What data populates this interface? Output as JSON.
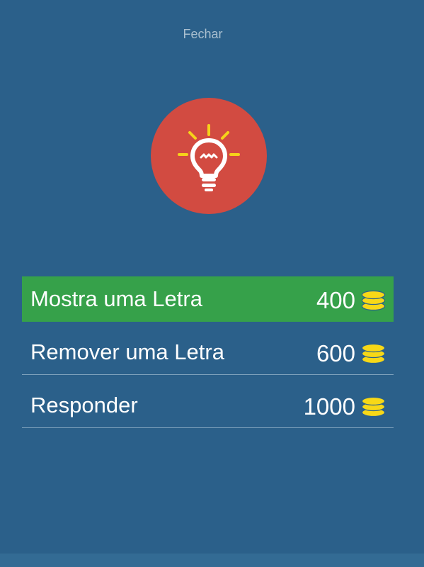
{
  "header": {
    "close_label": "Fechar"
  },
  "hint": {
    "icon": "lightbulb-icon",
    "circle_color": "#d24b41",
    "ray_color": "#f6d21a"
  },
  "options": [
    {
      "label": "Mostra uma Letra",
      "price": "400",
      "currency_icon": "coins-icon",
      "selected": true
    },
    {
      "label": "Remover uma Letra",
      "price": "600",
      "currency_icon": "coins-icon",
      "selected": false
    },
    {
      "label": "Responder",
      "price": "1000",
      "currency_icon": "coins-icon",
      "selected": false
    }
  ],
  "colors": {
    "background": "#2b608a",
    "selected_row": "#36a14a",
    "divider": "#7da1bb",
    "coin": "#f7d817"
  }
}
